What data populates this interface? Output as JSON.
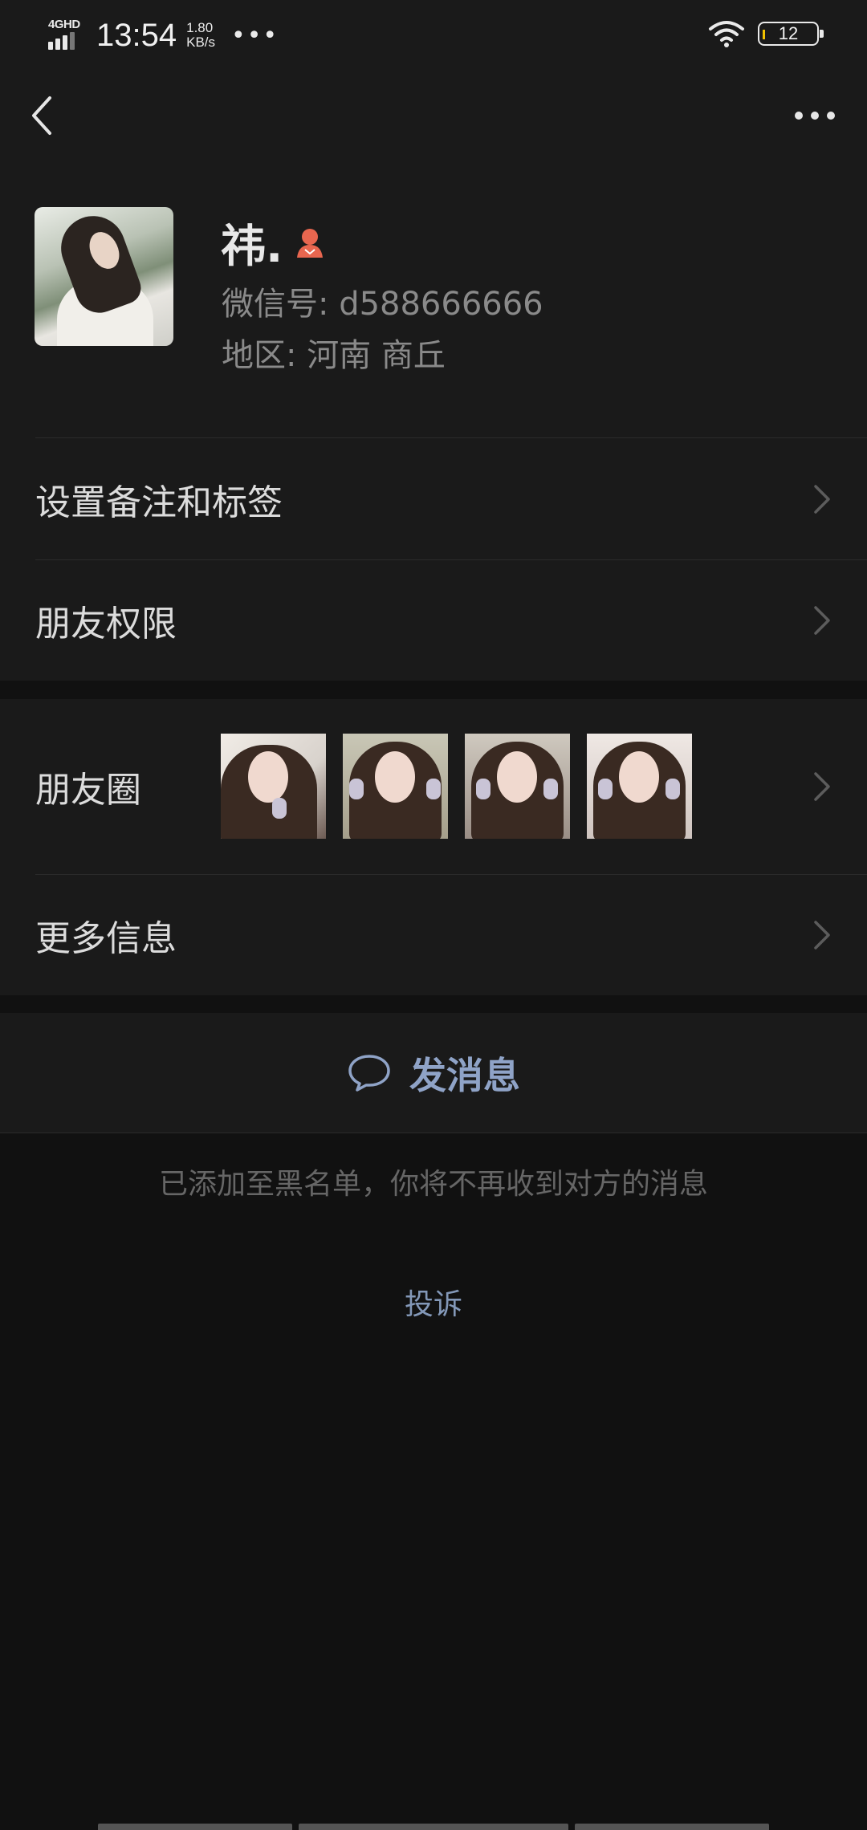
{
  "status_bar": {
    "network": "4GHD",
    "time": "13:54",
    "speed_value": "1.80",
    "speed_unit": "KB/s",
    "dots": "•••",
    "battery": "12"
  },
  "nav": {
    "back_icon": "chevron-left-icon",
    "more_icon": "more-dots-icon"
  },
  "profile": {
    "nickname": "祎.",
    "gender_icon": "female-icon",
    "gender_color": "#e8664f",
    "wechat_id": "微信号: d588666666",
    "region": "地区: 河南  商丘"
  },
  "menu_1": [
    {
      "label": "设置备注和标签"
    },
    {
      "label": "朋友权限"
    }
  ],
  "menu_2": {
    "moments_label": "朋友圈",
    "moments_thumb_count": 4,
    "more_info_label": "更多信息"
  },
  "actions": {
    "send_message": "发消息",
    "send_icon": "chat-bubble-icon",
    "accent_color": "#8fa3c7"
  },
  "blacklist_note": "已添加至黑名单，你将不再收到对方的消息",
  "complain": "投诉"
}
